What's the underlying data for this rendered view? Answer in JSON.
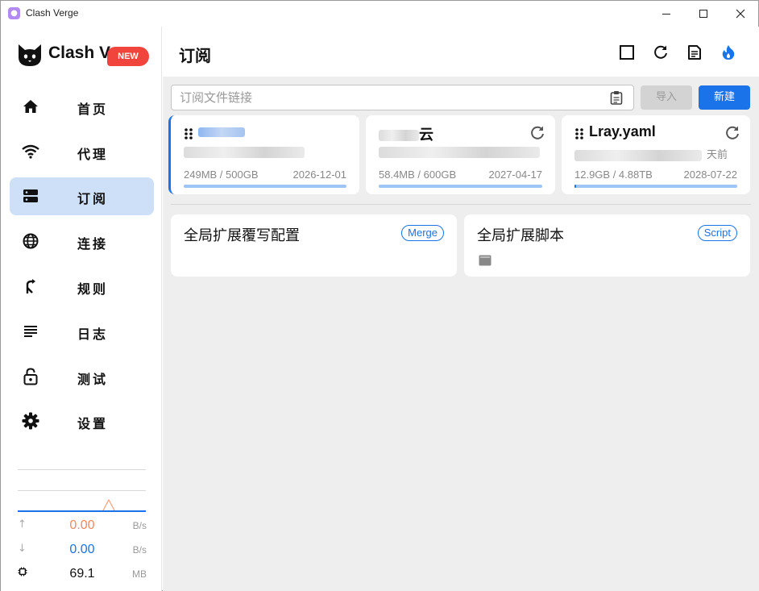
{
  "window": {
    "title": "Clash Verge"
  },
  "sidebar": {
    "logo_text": "Clash Verge",
    "badge": "NEW",
    "items": [
      {
        "label": "首页",
        "icon": "home-icon",
        "active": false
      },
      {
        "label": "代理",
        "icon": "wifi-icon",
        "active": false
      },
      {
        "label": "订阅",
        "icon": "dns-icon",
        "active": true
      },
      {
        "label": "连接",
        "icon": "globe-icon",
        "active": false
      },
      {
        "label": "规则",
        "icon": "fork-icon",
        "active": false
      },
      {
        "label": "日志",
        "icon": "lines-icon",
        "active": false
      },
      {
        "label": "测试",
        "icon": "lock-open-icon",
        "active": false
      },
      {
        "label": "设置",
        "icon": "gear-icon",
        "active": false
      }
    ],
    "traffic": {
      "up": {
        "value": "0.00",
        "unit": "B/s",
        "color": "#f08a5d"
      },
      "down": {
        "value": "0.00",
        "unit": "B/s",
        "color": "#1a73e8"
      },
      "memory": {
        "value": "69.1",
        "unit": "MB"
      }
    }
  },
  "header": {
    "title": "订阅"
  },
  "toolbar": {
    "url_placeholder": "订阅文件链接",
    "import_label": "导入",
    "new_label": "新建"
  },
  "profiles": [
    {
      "name": "",
      "sub": "",
      "usage": "249MB / 500GB",
      "expire": "2026-12-01",
      "used_fraction": 0.0,
      "selected": true
    },
    {
      "name": "云",
      "sub": "",
      "usage": "58.4MB / 600GB",
      "expire": "2027-04-17",
      "used_fraction": 0.0,
      "selected": false
    },
    {
      "name": "Lray.yaml",
      "sub": "天前",
      "usage": "12.9GB / 4.88TB",
      "expire": "2028-07-22",
      "used_fraction": 0.003,
      "selected": false
    }
  ],
  "extensions": [
    {
      "title": "全局扩展覆写配置",
      "tag": "Merge"
    },
    {
      "title": "全局扩展脚本",
      "tag": "Script"
    }
  ],
  "colors": {
    "accent": "#1a73e8",
    "active_nav": "#cde0f8",
    "badge": "#f0443c"
  }
}
